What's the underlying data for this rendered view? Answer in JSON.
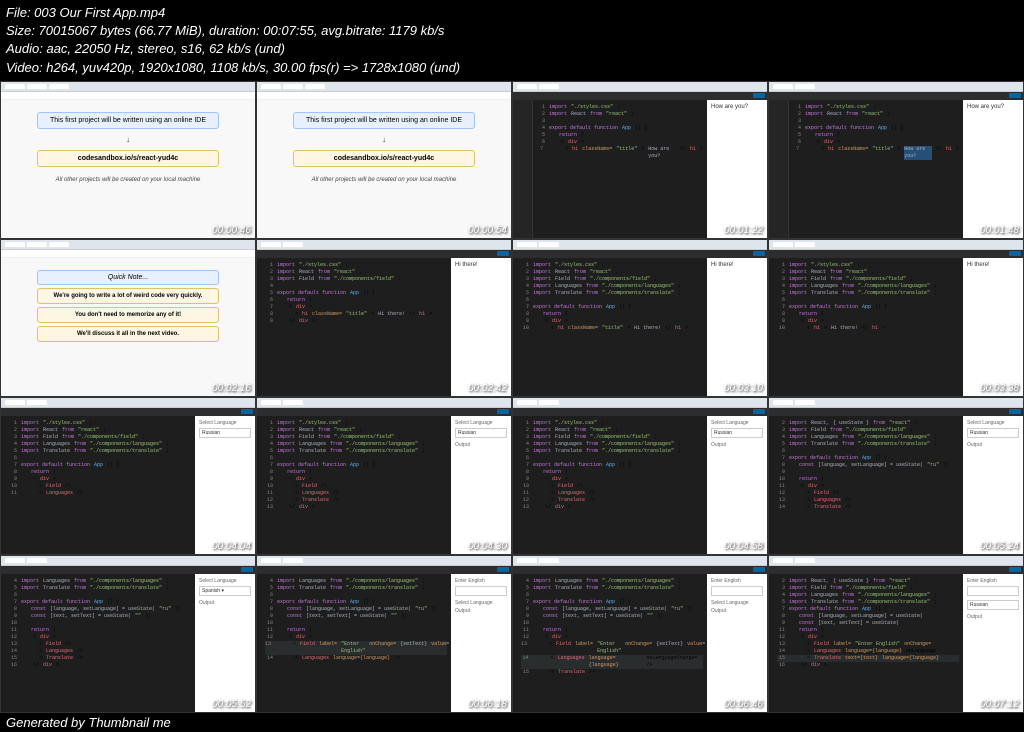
{
  "header": {
    "file": "File: 003 Our First App.mp4",
    "size": "Size: 70015067 bytes (66.77 MiB), duration: 00:07:55, avg.bitrate: 1179 kb/s",
    "audio": "Audio: aac, 22050 Hz, stereo, s16, 62 kb/s (und)",
    "video": "Video: h264, yuv420p, 1920x1080, 1108 kb/s, 30.00 fps(r) => 1728x1080 (und)"
  },
  "footer": "Generated by Thumbnail me",
  "slide1": {
    "title": "This first project will be written using an online IDE",
    "url": "codesandbox.io/s/react-yud4c",
    "note": "All other projects will be created on your local machine"
  },
  "slide2": {
    "title": "Quick Note...",
    "l1": "We're going to write a lot of weird code very quickly.",
    "l2": "You don't need to memorize any of it!",
    "l3": "We'll discuss it all in the next video."
  },
  "code": {
    "imp1": "import",
    "styles": "\"./styles.css\"",
    "react": "React",
    "from": "from",
    "reactpkg": "\"react\"",
    "field": "Field",
    "fieldpkg": "\"./components/field\"",
    "lang": "Languages",
    "langpkg": "\"./components/languages\"",
    "trans": "Translate",
    "transpkg": "\"./components/translate\"",
    "usestate": "{ useState }",
    "expdef": "export default function",
    "app": "App",
    "const": "const",
    "state": "[language, setLanguage] = useState(",
    "stateval": "\"ru\"",
    "statetext": "[text, setText] = useState(",
    "return": "return",
    "div": "div",
    "h1": "h1",
    "cls": "className=",
    "clsval": "\"title\"",
    "hello": "How are you?",
    "hithere": "Hi there!",
    "fieldtag": "Field",
    "langtag": "Languages",
    "transtag": "Translate",
    "label": "label=",
    "labelval": "\"Enter English\"",
    "onchange": "onChange=",
    "settext": "{setText}",
    "value": "value=",
    "textval": "{text}",
    "langval": "language={language}",
    "textprop": "text={text}",
    "langprop": "language={language}"
  },
  "preview": {
    "howare": "How are you?",
    "hithere": "Hi there!",
    "sellang": "Select Language",
    "russian": "Russian",
    "entereng": "Enter English",
    "output": "Output"
  },
  "ts": [
    "00:00:46",
    "00:00:54",
    "00:01:22",
    "00:01:48",
    "00:02:16",
    "00:02:42",
    "00:03:10",
    "00:03:38",
    "00:04:04",
    "00:04:30",
    "00:04:58",
    "00:05:24",
    "00:05:52",
    "00:06:18",
    "00:06:46",
    "00:07:12"
  ]
}
